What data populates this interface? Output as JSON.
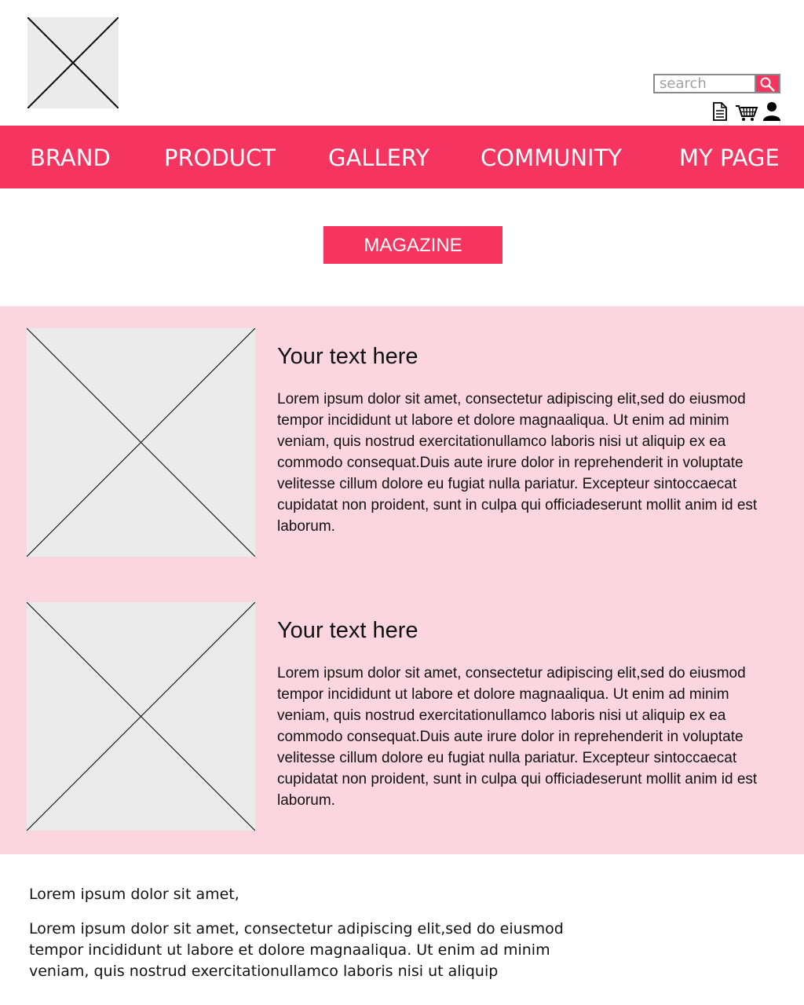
{
  "header": {
    "logo_icon": "image-placeholder-icon",
    "search": {
      "placeholder": "search",
      "button_icon": "search-icon"
    },
    "utility_icons": [
      "document-icon",
      "cart-icon",
      "user-icon"
    ]
  },
  "nav": {
    "items": [
      {
        "label": "BRAND"
      },
      {
        "label": "PRODUCT"
      },
      {
        "label": "GALLERY"
      },
      {
        "label": "COMMUNITY"
      },
      {
        "label": "MY PAGE"
      }
    ]
  },
  "magazine": {
    "label": "MAGAZINE"
  },
  "articles": [
    {
      "image_icon": "image-placeholder-icon",
      "title": "Your text here",
      "body": "Lorem ipsum dolor sit amet, consectetur adipiscing elit,sed do eiusmod tempor incididunt ut labore et dolore magnaaliqua. Ut enim ad minim veniam, quis nostrud exercitationullamco laboris nisi ut aliquip ex ea commodo consequat.Duis aute irure dolor in reprehenderit in voluptate velitesse cillum dolore eu fugiat nulla pariatur. Excepteur sintoccaecat cupidatat non proident, sunt in culpa qui officiadeserunt mollit anim id est laborum."
    },
    {
      "image_icon": "image-placeholder-icon",
      "title": "Your text here",
      "body": "Lorem ipsum dolor sit amet, consectetur adipiscing elit,sed do eiusmod tempor incididunt ut labore et dolore magnaaliqua. Ut enim ad minim veniam, quis nostrud exercitationullamco laboris nisi ut aliquip ex ea commodo consequat.Duis aute irure dolor in reprehenderit in voluptate velitesse cillum dolore eu fugiat nulla pariatur. Excepteur sintoccaecat cupidatat non proident, sunt in culpa qui officiadeserunt mollit anim id est laborum."
    }
  ],
  "footer": {
    "heading": "Lorem ipsum dolor sit amet,",
    "text": "Lorem ipsum dolor sit amet, consectetur adipiscing elit,sed do eiusmod tempor incididunt ut labore et dolore magnaaliqua. Ut enim ad minim veniam, quis nostrud exercitationullamco laboris nisi ut aliquip"
  },
  "colors": {
    "accent": "#f53560",
    "section_background": "#fbd6de",
    "placeholder_fill": "#ebebeb"
  }
}
